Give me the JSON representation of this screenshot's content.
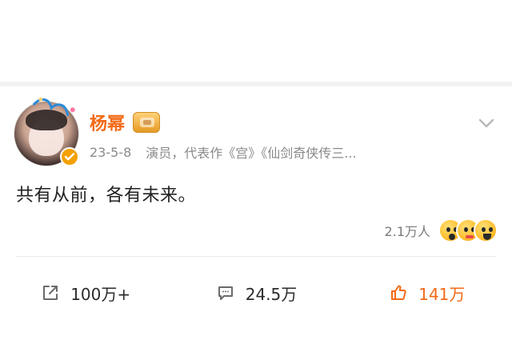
{
  "post": {
    "user_name": "杨幂",
    "date": "23-5-8",
    "source": "演员，代表作《宫》《仙剑奇侠传三...",
    "text": "共有从前，各有未来。"
  },
  "reactions": {
    "count_text": "2.1万人",
    "emojis": [
      "surprised-emoji-icon",
      "kiss-emoji-icon",
      "laugh-emoji-icon"
    ]
  },
  "actions": {
    "share_count": "100万+",
    "comment_count": "24.5万",
    "like_count": "141万"
  },
  "colors": {
    "name": "#f26a16",
    "like": "#f26a16",
    "meta": "#8a8a8a",
    "text": "#222222",
    "divider": "#f2f2f2"
  },
  "icons": {
    "share": "share-icon",
    "comment": "comment-icon",
    "like": "thumbs-up-icon",
    "more": "chevron-down-icon",
    "verified": "verified-badge-icon",
    "vip": "vip-crown-icon"
  }
}
